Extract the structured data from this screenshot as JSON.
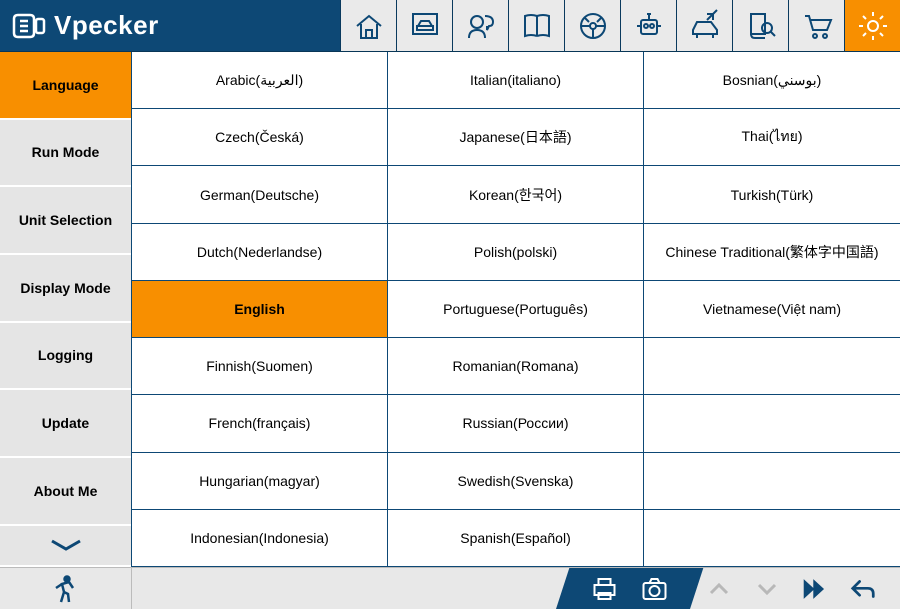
{
  "brand": "Vpecker",
  "sidebar": {
    "items": [
      {
        "label": "Language",
        "active": true
      },
      {
        "label": "Run Mode",
        "active": false
      },
      {
        "label": "Unit Selection",
        "active": false
      },
      {
        "label": "Display Mode",
        "active": false
      },
      {
        "label": "Logging",
        "active": false
      },
      {
        "label": "Update",
        "active": false
      },
      {
        "label": "About Me",
        "active": false
      }
    ]
  },
  "languages": {
    "columns": [
      [
        "Arabic(العربية)",
        "Czech(Česká)",
        "German(Deutsche)",
        "Dutch(Nederlandse)",
        "English",
        "Finnish(Suomen)",
        "French(français)",
        "Hungarian(magyar)",
        "Indonesian(Indonesia)"
      ],
      [
        "Italian(italiano)",
        "Japanese(日本語)",
        "Korean(한국어)",
        "Polish(polski)",
        "Portuguese(Português)",
        "Romanian(Romana)",
        "Russian(России)",
        "Swedish(Svenska)",
        "Spanish(Español)"
      ],
      [
        "Bosnian(بوسني)",
        "Thai(ไทย)",
        "Turkish(Türk)",
        "Chinese Traditional(繁体字中国語)",
        "Vietnamese(Việt nam)",
        "",
        "",
        "",
        ""
      ]
    ],
    "selected": "English"
  },
  "toolbar": {
    "items": [
      "home",
      "vehicle",
      "support",
      "manual",
      "diag",
      "robot",
      "car-diag",
      "book-search",
      "cart",
      "settings"
    ],
    "active": "settings"
  }
}
